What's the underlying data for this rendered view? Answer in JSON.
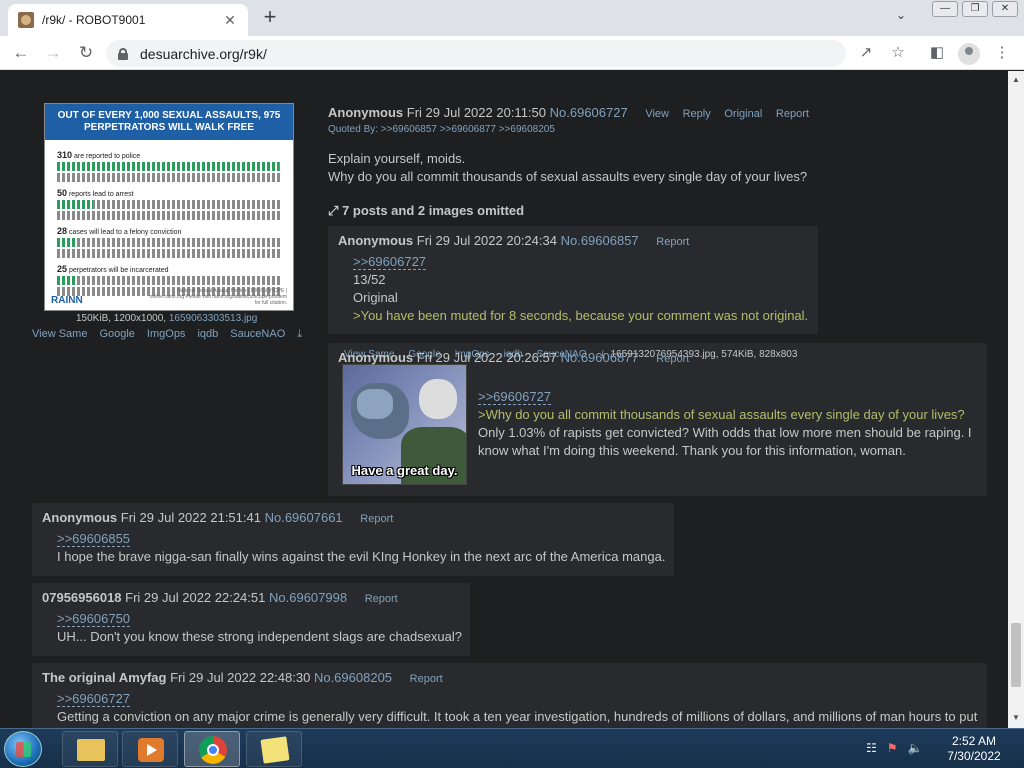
{
  "browser": {
    "tab_title": "/r9k/ - ROBOT9001",
    "tab_close": "✕",
    "new_tab": "+",
    "url": "desuarchive.org/r9k/",
    "window_buttons": [
      "—",
      "❐",
      "✕"
    ]
  },
  "op": {
    "thumbnail": {
      "headline": "OUT OF EVERY 1,000 SEXUAL ASSAULTS, 975 PERPETRATORS WILL WALK FREE",
      "rows": [
        {
          "count": "310",
          "text": "are reported to police",
          "fraction": 0.31
        },
        {
          "count": "50",
          "text": "reports lead to arrest",
          "fraction": 0.05
        },
        {
          "count": "28",
          "text": "cases will lead to a felony conviction",
          "fraction": 0.028
        },
        {
          "count": "25",
          "text": "perpetrators will be incarcerated",
          "fraction": 0.025
        }
      ],
      "logo": "RAINN",
      "footer": "National Sexual Assault Hotline | 800.656.HOPE | online.rainn.org Please visit rainn.org/statistics/scope-problem for full citation."
    },
    "file_size": "150KiB, 1200x1000,",
    "file_name": "1659063303513.jpg",
    "tools": [
      "View Same",
      "Google",
      "ImgOps",
      "iqdb",
      "SauceNAO"
    ],
    "name": "Anonymous",
    "date": "Fri 29 Jul 2022 20:11:50",
    "number": "No.69606727",
    "links": [
      "View",
      "Reply",
      "Original",
      "Report"
    ],
    "quoted_by": "Quoted By: >>69606857 >>69606877 >>69608205",
    "body": [
      "Explain yourself, moids.",
      "Why do you all commit thousands of sexual assaults every single day of your lives?"
    ],
    "omitted": "7 posts and 2 images omitted"
  },
  "replies": [
    {
      "name": "Anonymous",
      "date": "Fri 29 Jul 2022 20:24:34",
      "number": "No.69606857",
      "report": "Report",
      "quote": ">>69606727",
      "lines": [
        "13/52",
        "Original"
      ],
      "green": ">You have been muted for 8 seconds, because your comment was not original."
    },
    {
      "tools": [
        "View Same",
        "Google",
        "ImgOps",
        "iqdb",
        "SauceNAO"
      ],
      "file_name": "1659132076954393.jpg",
      "file_info": ", 574KiB, 828x803",
      "image_caption": "Have a great day.",
      "name": "Anonymous",
      "date": "Fri 29 Jul 2022 20:26:57",
      "number": "No.69606877",
      "report": "Report",
      "quote": ">>69606727",
      "green": ">Why do you all commit thousands of sexual assaults every single day of your lives?",
      "text": "Only 1.03% of rapists get convicted? With odds that low more men should be raping. I know what I'm doing this weekend. Thank you for this information, woman."
    },
    {
      "name": "Anonymous",
      "date": "Fri 29 Jul 2022 21:51:41",
      "number": "No.69607661",
      "report": "Report",
      "quote": ">>69606855",
      "text": "I hope the brave nigga-san finally wins against the evil KIng Honkey in the next arc of the America manga."
    },
    {
      "name": "07956956018",
      "date": "Fri 29 Jul 2022 22:24:51",
      "number": "No.69607998",
      "report": "Report",
      "quote": ">>69606750",
      "text": "UH... Don't you know these strong independent slags are chadsexual?"
    },
    {
      "name": "The original Amyfag",
      "date": "Fri 29 Jul 2022 22:48:30",
      "number": "No.69608205",
      "report": "Report",
      "quote": ">>69606727",
      "text": "Getting a conviction on any major crime is generally very difficult. It took a ten year investigation, hundreds of millions of dollars, and millions of man hours to put"
    }
  ],
  "taskbar": {
    "time": "2:52 AM",
    "date": "7/30/2022"
  }
}
